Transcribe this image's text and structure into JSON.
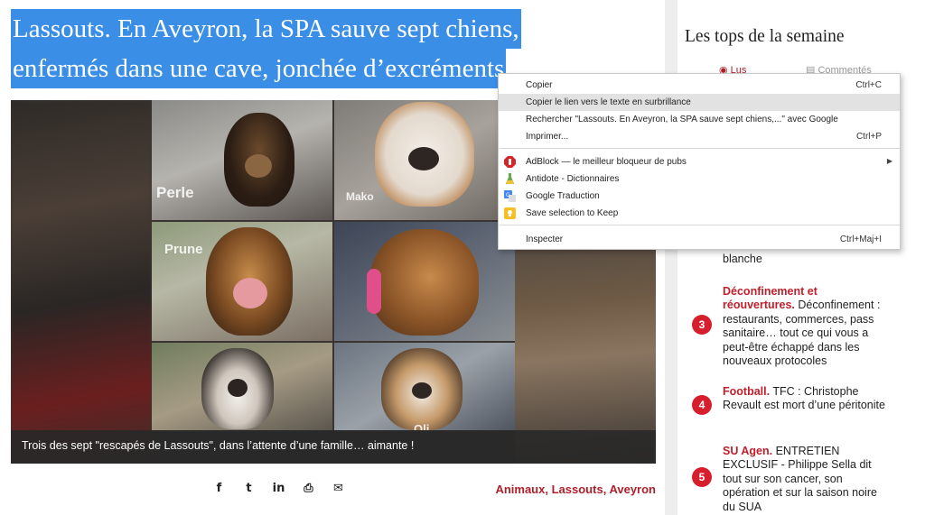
{
  "headline": {
    "line1": "Lassouts. En Aveyron, la SPA sauve sept chiens,",
    "line2": "enfermés dans une cave, jonchée d’excréments"
  },
  "photo": {
    "dog_names": [
      "Perle",
      "Mako",
      "Prune",
      "Oli"
    ],
    "caption": "Trois des sept \"rescapés de Lassouts\", dans l’attente d’une famille… aimante !"
  },
  "share": {
    "icons": [
      "facebook-icon",
      "twitter-icon",
      "linkedin-icon",
      "print-icon",
      "email-icon"
    ],
    "glyphs": [
      "f",
      "t",
      "in",
      "⎙",
      "✉"
    ]
  },
  "tags": [
    "Animaux",
    "Lassouts",
    "Aveyron"
  ],
  "tag_separator": ",",
  "sidebar": {
    "title": "Les tops de la semaine",
    "tabs": {
      "read": "Lus",
      "commented": "Commentés"
    },
    "items": [
      {
        "number": "",
        "category": "",
        "text": "blanche"
      },
      {
        "number": "3",
        "category": "Déconfinement et réouvertures.",
        "text": "Déconfinement : restaurants, commerces, pass sanitaire… tout ce qui vous a peut-être échappé dans les nouveaux protocoles"
      },
      {
        "number": "4",
        "category": "Football.",
        "text": "TFC : Christophe Revault est mort d’une péritonite"
      },
      {
        "number": "5",
        "category": "SU Agen.",
        "text": "ENTRETIEN EXCLUSIF - Philippe Sella dit tout sur son cancer, son opération et sur la saison noire du SUA"
      }
    ]
  },
  "context_menu": {
    "copy": {
      "label": "Copier",
      "shortcut": "Ctrl+C"
    },
    "copy_link": {
      "label": "Copier le lien vers le texte en surbrillance"
    },
    "search": {
      "label": "Rechercher \"Lassouts. En Aveyron, la SPA sauve sept chiens,...\" avec Google"
    },
    "print": {
      "label": "Imprimer...",
      "shortcut": "Ctrl+P"
    },
    "adblock": {
      "label": "AdBlock — le meilleur bloqueur de pubs"
    },
    "antidote": {
      "label": "Antidote - Dictionnaires"
    },
    "translate": {
      "label": "Google Traduction"
    },
    "keep": {
      "label": "Save selection to Keep"
    },
    "inspect": {
      "label": "Inspecter",
      "shortcut": "Ctrl+Maj+I"
    }
  },
  "colors": {
    "selection": "#3a8ee6",
    "accent_red": "#d61f2c",
    "tag_red": "#b0202a"
  }
}
